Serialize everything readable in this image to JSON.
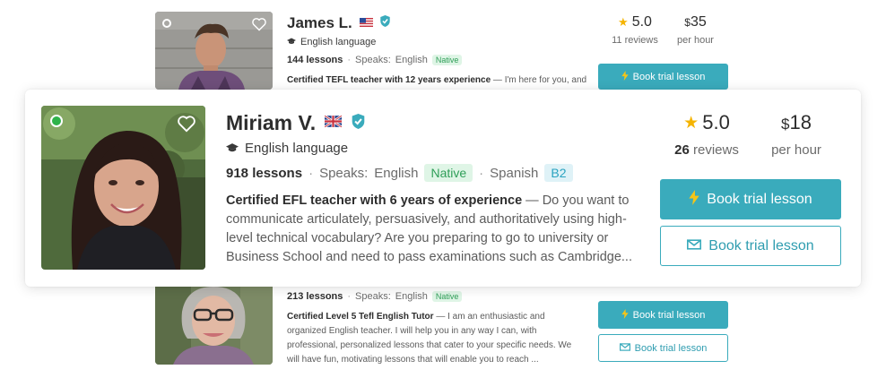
{
  "tutors_bg_top": {
    "name": "James L.",
    "subject": "English language",
    "lessons": "144 lessons",
    "speaks_label": "Speaks:",
    "language": "English",
    "language_level": "Native",
    "headline": "Certified TEFL teacher with 12 years experience",
    "description": " — I'm here for you, and",
    "rating": "5.0",
    "reviews": "11 reviews",
    "price": "35",
    "currency": "$",
    "per_hour": "per hour",
    "book_label": "Book trial lesson"
  },
  "featured": {
    "name": "Miriam V.",
    "subject": "English language",
    "lessons": "918 lessons",
    "speaks_label": "Speaks:",
    "language_1": "English",
    "language_1_level": "Native",
    "language_2": "Spanish",
    "language_2_level": "B2",
    "headline": "Certified EFL teacher with 6 years of experience",
    "description": " — Do you want to communicate articulately, persuasively, and authoritatively using high-level technical vocabulary? Are you preparing to go to university or Business School and need to pass examinations such as Cambridge...",
    "rating": "5.0",
    "reviews_count": "26",
    "reviews_label": " reviews",
    "price": "18",
    "currency": "$",
    "per_hour": "per hour",
    "book_label": "Book trial lesson",
    "message_label": "Book trial lesson"
  },
  "tutors_bg_bottom": {
    "lessons": "213 lessons",
    "speaks_label": "Speaks:",
    "language": "English",
    "language_level": "Native",
    "headline": "Certified Level 5 Tefl English Tutor",
    "description": " — I am an enthusiastic and organized English teacher. I will help you in any way I can, with professional, personalized lessons that cater to your specific needs. We will have fun, motivating lessons that will enable you to reach ...",
    "book_label": "Book trial lesson",
    "message_label": "Book trial lesson"
  },
  "colors": {
    "accent": "#3aabbc",
    "native_bg": "#dff5e6",
    "native_text": "#2f9e58",
    "star": "#f5b400",
    "online": "#2fb34a"
  }
}
